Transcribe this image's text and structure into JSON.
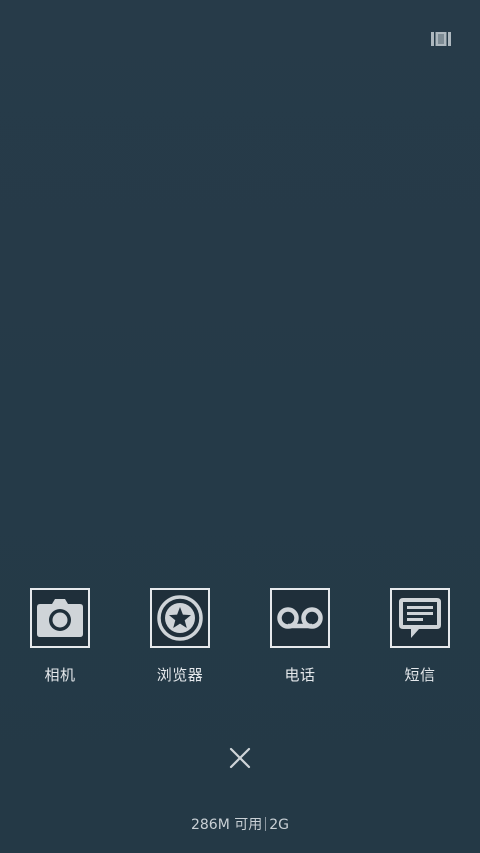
{
  "top_bar": {
    "action_icon": "recents-grid-icon"
  },
  "dock": {
    "items": [
      {
        "label": "相机",
        "icon": "camera-icon"
      },
      {
        "label": "浏览器",
        "icon": "browser-star-icon"
      },
      {
        "label": "电话",
        "icon": "voicemail-phone-icon"
      },
      {
        "label": "短信",
        "icon": "message-bubble-icon"
      }
    ]
  },
  "close": {
    "icon": "close-icon"
  },
  "memory": {
    "available": "286M 可用",
    "total": "2G"
  },
  "colors": {
    "background": "#253a48",
    "icon_border": "#e6e9ec",
    "icon_fill": "#cfd4d8",
    "text": "#e4e8eb"
  }
}
